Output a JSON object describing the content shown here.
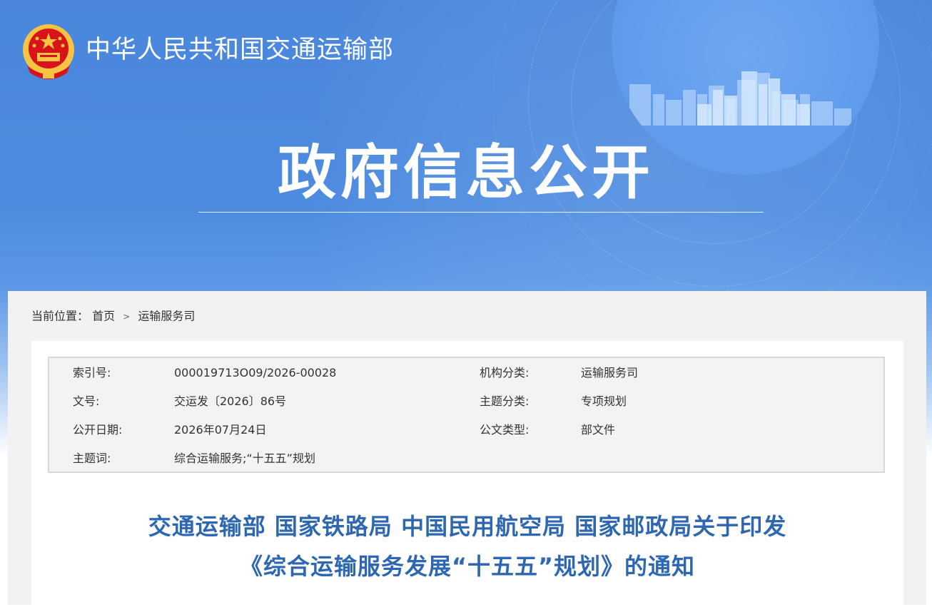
{
  "header": {
    "site_name": "中华人民共和国交通运输部",
    "hero_title": "政府信息公开"
  },
  "breadcrumb": {
    "prefix": "当前位置：",
    "home": "首页",
    "separator": ">",
    "current": "运输服务司"
  },
  "meta": {
    "rows": [
      {
        "k1": "索引号:",
        "v1": "000019713O09/2026-00028",
        "k2": "机构分类:",
        "v2": "运输服务司"
      },
      {
        "k1": "文号:",
        "v1": "交运发〔2026〕86号",
        "k2": "主题分类:",
        "v2": "专项规划"
      },
      {
        "k1": "公开日期:",
        "v1": "2026年07月24日",
        "k2": "公文类型:",
        "v2": "部文件"
      },
      {
        "k1": "主题词:",
        "v1": "综合运输服务;“十五五”规划",
        "k2": "",
        "v2": ""
      }
    ]
  },
  "document": {
    "title_line1": "交通运输部 国家铁路局 中国民用航空局 国家邮政局关于印发",
    "title_line2": "《综合运输服务发展“十五五”规划》的通知"
  },
  "colors": {
    "banner_blue": "#4a87dc",
    "title_blue": "#2e67b1",
    "panel_gray": "#f2f2f2",
    "emblem_red": "#d7141a",
    "emblem_gold": "#f6c342"
  },
  "icons": {
    "emblem": "national-emblem"
  }
}
